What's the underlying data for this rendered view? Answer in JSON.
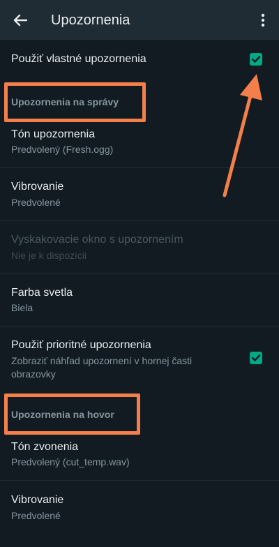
{
  "header": {
    "title": "Upozornenia",
    "back_icon": "arrow-left-icon",
    "menu_icon": "more-vertical-icon"
  },
  "custom_notifications": {
    "label": "Použiť vlastné upozornenia",
    "checked": true
  },
  "sections": {
    "messages_header": "Upozornenia na správy",
    "calls_header": "Upozornenia na hovor"
  },
  "messages": {
    "tone_title": "Tón upozornenia",
    "tone_value": "Predvolený (Fresh.ogg)",
    "vibrate_title": "Vibrovanie",
    "vibrate_value": "Predvolené",
    "popup_title": "Vyskakovacie okno s upozornením",
    "popup_value": "Nie je k dispozícii",
    "light_title": "Farba svetla",
    "light_value": "Biela",
    "priority_title": "Použiť prioritné upozornenia",
    "priority_value": "Zobraziť náhľad upozornení v hornej časti obrazovky",
    "priority_checked": true
  },
  "calls": {
    "ringtone_title": "Tón zvonenia",
    "ringtone_value": "Predvolený (cut_temp.wav)",
    "vibrate_title": "Vibrovanie",
    "vibrate_value": "Predvolené"
  },
  "colors": {
    "background": "#111b21",
    "appbar": "#1f2c34",
    "accent": "#00a884",
    "annotation": "#f47f4b"
  }
}
